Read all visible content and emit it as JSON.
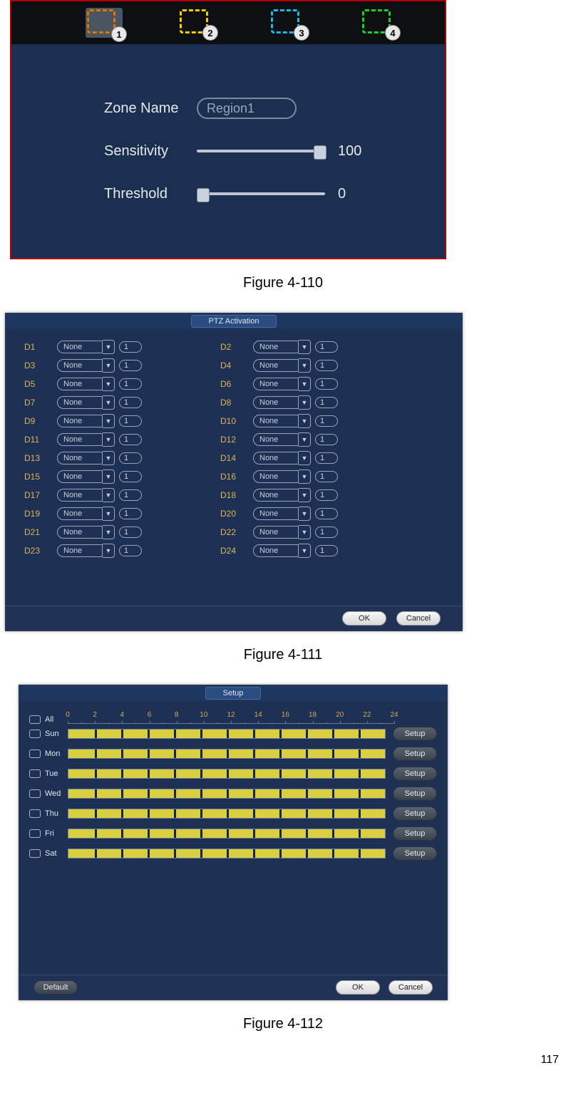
{
  "page_number": "117",
  "fig110": {
    "caption": "Figure 4-110",
    "tabs": [
      "1",
      "2",
      "3",
      "4"
    ],
    "selected_tab": 1,
    "zone_name_label": "Zone Name",
    "zone_name_value": "Region1",
    "sensitivity_label": "Sensitivity",
    "sensitivity_value": "100",
    "sensitivity_pct": 100,
    "threshold_label": "Threshold",
    "threshold_value": "0",
    "threshold_pct": 0
  },
  "fig111": {
    "caption": "Figure 4-111",
    "title": "PTZ Activation",
    "ok": "OK",
    "cancel": "Cancel",
    "left": [
      {
        "ch": "D1",
        "opt": "None",
        "preset": "1"
      },
      {
        "ch": "D3",
        "opt": "None",
        "preset": "1"
      },
      {
        "ch": "D5",
        "opt": "None",
        "preset": "1"
      },
      {
        "ch": "D7",
        "opt": "None",
        "preset": "1"
      },
      {
        "ch": "D9",
        "opt": "None",
        "preset": "1"
      },
      {
        "ch": "D11",
        "opt": "None",
        "preset": "1"
      },
      {
        "ch": "D13",
        "opt": "None",
        "preset": "1"
      },
      {
        "ch": "D15",
        "opt": "None",
        "preset": "1"
      },
      {
        "ch": "D17",
        "opt": "None",
        "preset": "1"
      },
      {
        "ch": "D19",
        "opt": "None",
        "preset": "1"
      },
      {
        "ch": "D21",
        "opt": "None",
        "preset": "1"
      },
      {
        "ch": "D23",
        "opt": "None",
        "preset": "1"
      }
    ],
    "right": [
      {
        "ch": "D2",
        "opt": "None",
        "preset": "1"
      },
      {
        "ch": "D4",
        "opt": "None",
        "preset": "1"
      },
      {
        "ch": "D6",
        "opt": "None",
        "preset": "1"
      },
      {
        "ch": "D8",
        "opt": "None",
        "preset": "1"
      },
      {
        "ch": "D10",
        "opt": "None",
        "preset": "1"
      },
      {
        "ch": "D12",
        "opt": "None",
        "preset": "1"
      },
      {
        "ch": "D14",
        "opt": "None",
        "preset": "1"
      },
      {
        "ch": "D16",
        "opt": "None",
        "preset": "1"
      },
      {
        "ch": "D18",
        "opt": "None",
        "preset": "1"
      },
      {
        "ch": "D20",
        "opt": "None",
        "preset": "1"
      },
      {
        "ch": "D22",
        "opt": "None",
        "preset": "1"
      },
      {
        "ch": "D24",
        "opt": "None",
        "preset": "1"
      }
    ]
  },
  "fig112": {
    "caption": "Figure 4-112",
    "title": "Setup",
    "hours": [
      "0",
      "2",
      "4",
      "6",
      "8",
      "10",
      "12",
      "14",
      "16",
      "18",
      "20",
      "22",
      "24"
    ],
    "all": "All",
    "days": [
      "Sun",
      "Mon",
      "Tue",
      "Wed",
      "Thu",
      "Fri",
      "Sat"
    ],
    "setup": "Setup",
    "default": "Default",
    "ok": "OK",
    "cancel": "Cancel"
  }
}
